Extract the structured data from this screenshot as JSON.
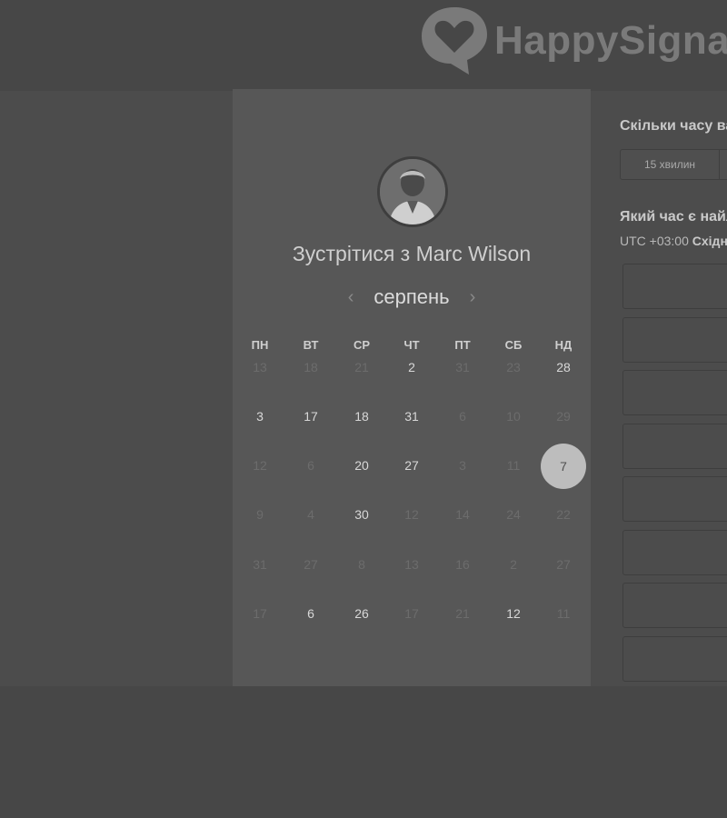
{
  "brand": {
    "name": "HappySigna"
  },
  "meeting": {
    "title": "Зустрітися з Marc Wilson"
  },
  "calendar": {
    "month": "серпень",
    "prev_arrow": "‹",
    "next_arrow": "›",
    "weekdays": [
      "ПН",
      "ВТ",
      "СР",
      "ЧТ",
      "ПТ",
      "СБ",
      "НД"
    ],
    "weeks": [
      [
        {
          "d": "13",
          "a": false
        },
        {
          "d": "18",
          "a": false
        },
        {
          "d": "21",
          "a": false
        },
        {
          "d": "2",
          "a": true
        },
        {
          "d": "31",
          "a": false
        },
        {
          "d": "23",
          "a": false
        },
        {
          "d": "28",
          "a": true
        }
      ],
      [
        {
          "d": "3",
          "a": true
        },
        {
          "d": "17",
          "a": true
        },
        {
          "d": "18",
          "a": true
        },
        {
          "d": "31",
          "a": true
        },
        {
          "d": "6",
          "a": false
        },
        {
          "d": "10",
          "a": false
        },
        {
          "d": "29",
          "a": false
        }
      ],
      [
        {
          "d": "12",
          "a": false
        },
        {
          "d": "6",
          "a": false
        },
        {
          "d": "20",
          "a": true
        },
        {
          "d": "27",
          "a": true
        },
        {
          "d": "3",
          "a": false
        },
        {
          "d": "11",
          "a": false
        },
        {
          "d": "7",
          "a": true,
          "selected": true
        }
      ],
      [
        {
          "d": "9",
          "a": false
        },
        {
          "d": "4",
          "a": false
        },
        {
          "d": "30",
          "a": true
        },
        {
          "d": "12",
          "a": false
        },
        {
          "d": "14",
          "a": false
        },
        {
          "d": "24",
          "a": false
        },
        {
          "d": "22",
          "a": false
        }
      ],
      [
        {
          "d": "31",
          "a": false
        },
        {
          "d": "27",
          "a": false
        },
        {
          "d": "8",
          "a": false
        },
        {
          "d": "13",
          "a": false
        },
        {
          "d": "16",
          "a": false
        },
        {
          "d": "2",
          "a": false
        },
        {
          "d": "27",
          "a": false
        }
      ],
      [
        {
          "d": "17",
          "a": false
        },
        {
          "d": "6",
          "a": true
        },
        {
          "d": "26",
          "a": true
        },
        {
          "d": "17",
          "a": false
        },
        {
          "d": "21",
          "a": false
        },
        {
          "d": "12",
          "a": true
        },
        {
          "d": "11",
          "a": false
        }
      ]
    ]
  },
  "right": {
    "duration_question": "Скільки часу ва",
    "duration_option": "15 хвилин",
    "time_question": "Який час є найл",
    "tz_prefix": "UTC +03:00",
    "tz_name": "Східн",
    "slot_count": 8
  },
  "colors": {
    "selected_day": "#bdbdbd",
    "card": "#575757"
  }
}
